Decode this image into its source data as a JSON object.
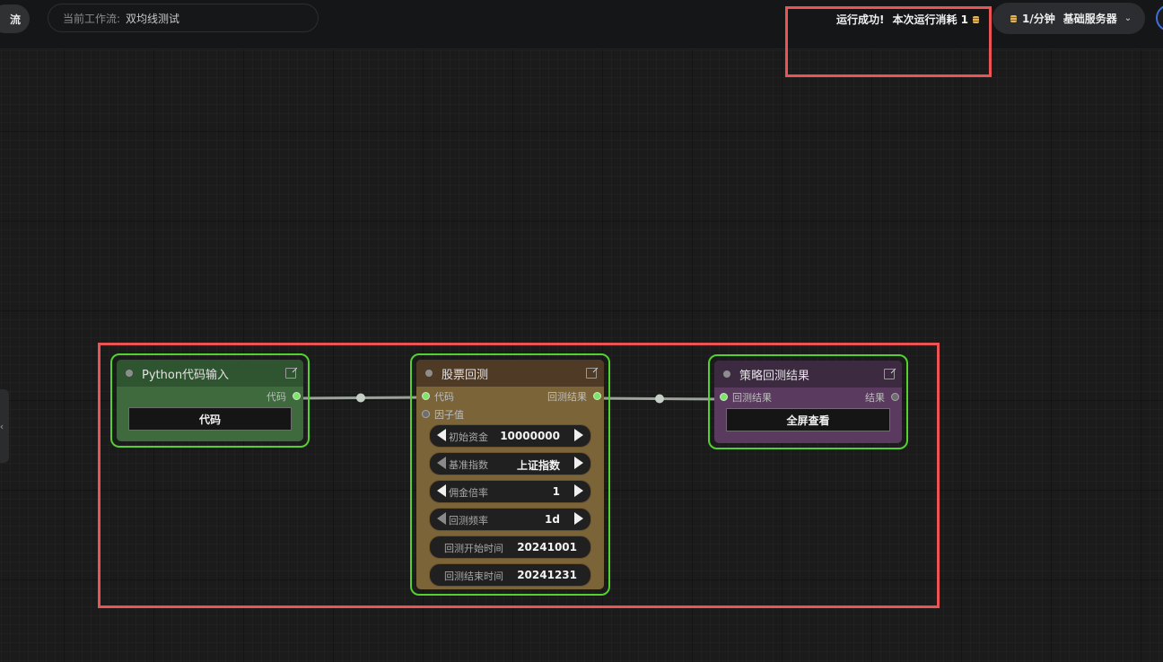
{
  "topbar": {
    "left_button_label": "流",
    "workflow_label": "当前工作流:",
    "workflow_name": "双均线测试",
    "status": "运行成功!",
    "cost_text": "本次运行消耗 1",
    "rate": "1/分钟",
    "server": "基础服务器"
  },
  "nodes": {
    "python": {
      "title": "Python代码输入",
      "output_label": "代码",
      "button": "代码"
    },
    "backtest": {
      "title": "股票回测",
      "input_code": "代码",
      "input_factor": "因子值",
      "output_label": "回测结果",
      "widgets": [
        {
          "label": "初始资金",
          "value": "10000000"
        },
        {
          "label": "基准指数",
          "value": "上证指数"
        },
        {
          "label": "佣金倍率",
          "value": "1"
        },
        {
          "label": "回测频率",
          "value": "1d"
        },
        {
          "label": "回测开始时间",
          "value": "20241001"
        },
        {
          "label": "回测结束时间",
          "value": "20241231"
        }
      ]
    },
    "result": {
      "title": "策略回测结果",
      "input_label": "回测结果",
      "output_label": "结果",
      "button": "全屏查看"
    }
  },
  "colors": {
    "highlight": "#ea5455",
    "node_outline": "#52d130",
    "python_node": "#3e6a3e",
    "backtest_node": "#7a6438",
    "result_node": "#5a3a5e"
  }
}
